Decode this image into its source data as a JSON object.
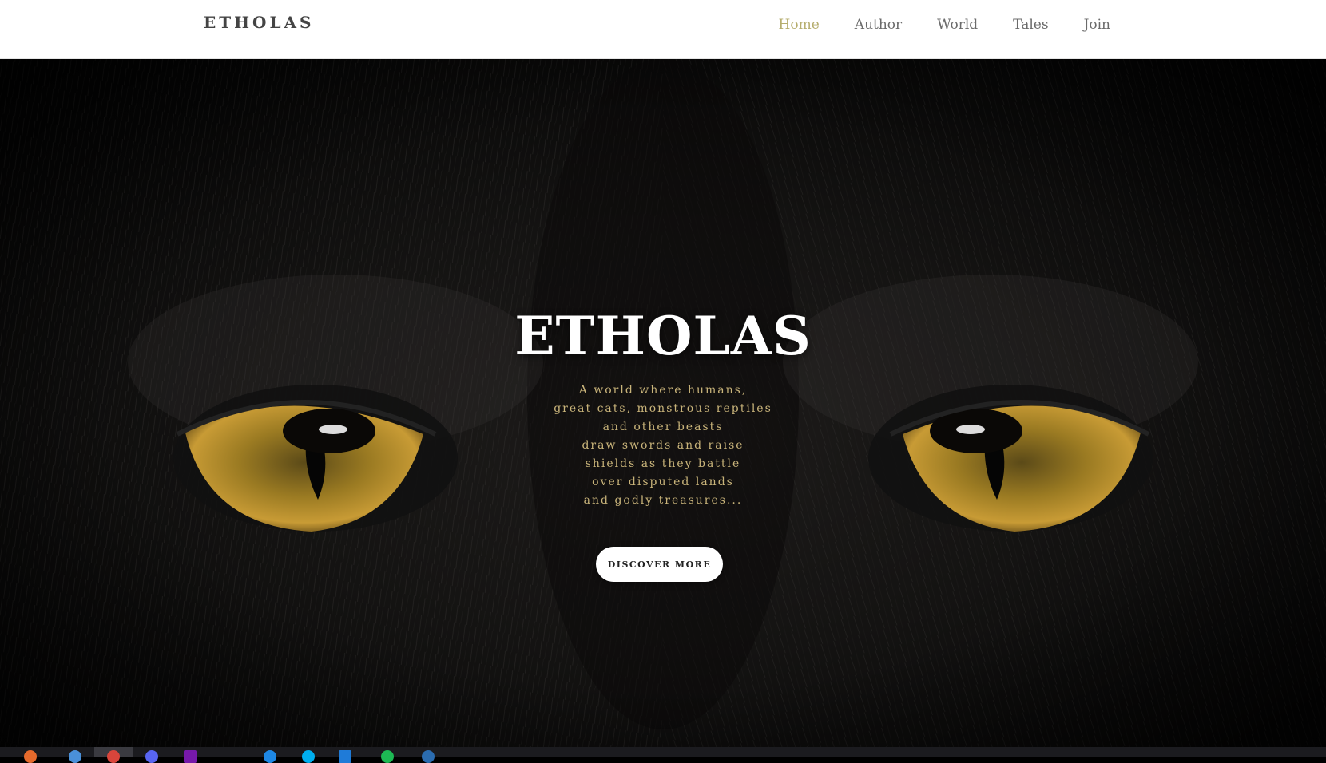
{
  "site": {
    "brand": "ETHOLAS",
    "nav": [
      {
        "label": "Home",
        "active": true
      },
      {
        "label": "Author",
        "active": false
      },
      {
        "label": "World",
        "active": false
      },
      {
        "label": "Tales",
        "active": false
      },
      {
        "label": "Join",
        "active": false
      }
    ]
  },
  "hero": {
    "title": "ETHOLAS",
    "tagline": [
      "A world where humans,",
      "great cats, monstrous reptiles",
      "and other beasts",
      "draw swords and raise",
      "shields as they battle",
      "over disputed lands",
      "and godly treasures..."
    ],
    "cta_label": "DISCOVER MORE"
  },
  "colors": {
    "nav_active": "#b6ad6e",
    "nav_default": "#6b6b6b",
    "tagline": "#c9b47a",
    "hero_background": "#050505",
    "eye": "#b8912a"
  },
  "taskbar": {
    "icons": [
      "firefox-icon",
      "chrome-icon",
      "opera-icon",
      "discord-icon",
      "onenote-icon",
      "edge-icon",
      "skype-icon",
      "vscode-icon",
      "spotify-icon",
      "app-icon"
    ]
  }
}
